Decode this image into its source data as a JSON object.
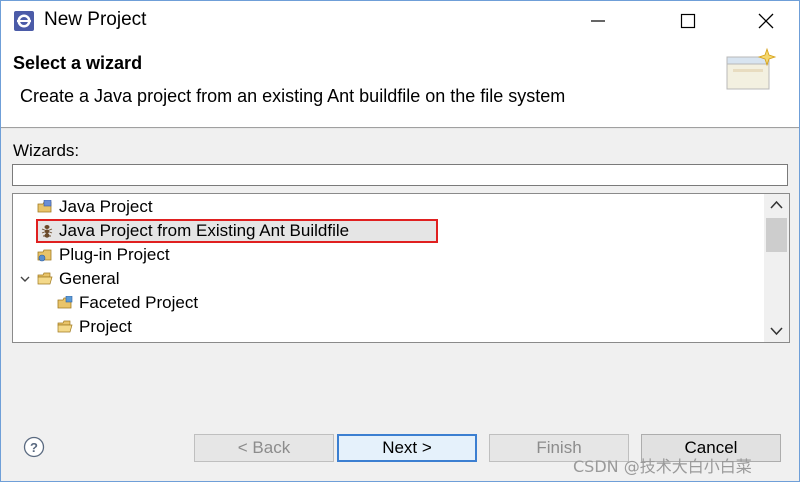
{
  "window": {
    "title": "New Project",
    "icon": "eclipse-icon"
  },
  "header": {
    "title": "Select a wizard",
    "description": "Create a Java project from an existing Ant buildfile on the file system",
    "banner_icon": "wizard-banner-icon"
  },
  "wizards": {
    "label": "Wizards:",
    "filter_value": "",
    "items": [
      {
        "label": "Java Project",
        "icon": "java-project-icon",
        "selected": false
      },
      {
        "label": "Java Project from Existing Ant Buildfile",
        "icon": "ant-icon",
        "selected": true
      },
      {
        "label": "Plug-in Project",
        "icon": "plugin-project-icon",
        "selected": false
      },
      {
        "label": "General",
        "icon": "folder-open-icon",
        "expanded": true
      },
      {
        "label": "Faceted Project",
        "icon": "faceted-project-icon",
        "selected": false
      },
      {
        "label": "Project",
        "icon": "folder-open-icon",
        "selected": false
      }
    ]
  },
  "buttons": {
    "back": "< Back",
    "next": "Next >",
    "finish": "Finish",
    "cancel": "Cancel"
  },
  "watermark": "CSDN @技术大白小白菜",
  "colors": {
    "selection_border": "#e02020",
    "default_button_border": "#3c7fd1"
  }
}
